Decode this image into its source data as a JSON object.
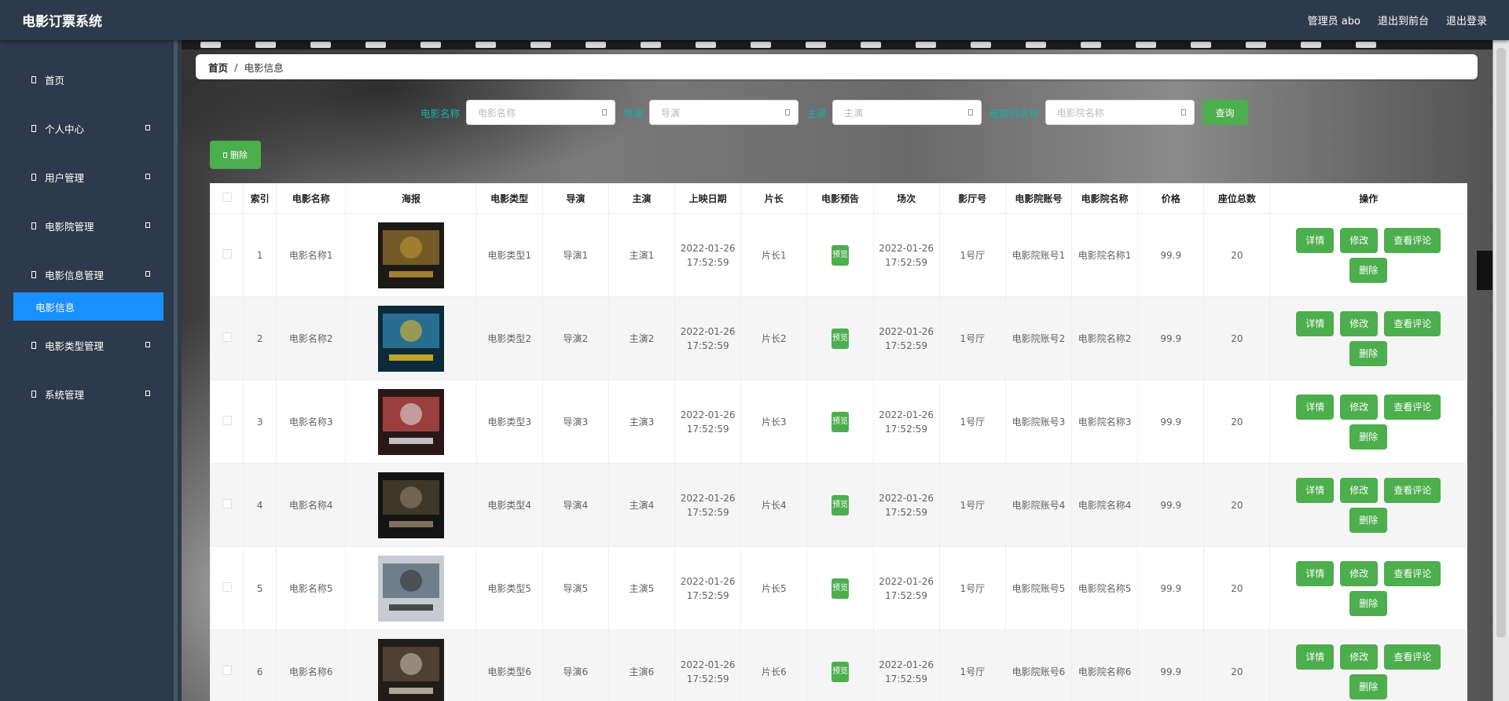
{
  "header": {
    "title": "电影订票系统",
    "user": "管理员 abo",
    "to_front": "退出到前台",
    "logout": "退出登录"
  },
  "sidebar": {
    "items": [
      {
        "label": "首页",
        "has_arrow": false
      },
      {
        "label": "个人中心",
        "has_arrow": true
      },
      {
        "label": "用户管理",
        "has_arrow": true
      },
      {
        "label": "电影院管理",
        "has_arrow": true
      },
      {
        "label": "电影信息管理",
        "has_arrow": true
      },
      {
        "label": "电影类型管理",
        "has_arrow": true
      },
      {
        "label": "系统管理",
        "has_arrow": true
      }
    ],
    "active_sub": "电影信息"
  },
  "breadcrumb": {
    "home": "首页",
    "separator": "/",
    "current": "电影信息"
  },
  "search": {
    "fields": [
      {
        "label": "电影名称",
        "placeholder": "电影名称"
      },
      {
        "label": "导演",
        "placeholder": "导演"
      },
      {
        "label": "主演",
        "placeholder": "主演"
      },
      {
        "label": "电影院名称",
        "placeholder": "电影院名称"
      }
    ],
    "query_label": "查询"
  },
  "toolbar": {
    "delete_label": "删除"
  },
  "table": {
    "columns": [
      "索引",
      "电影名称",
      "海报",
      "电影类型",
      "导演",
      "主演",
      "上映日期",
      "片长",
      "电影预告",
      "场次",
      "影厅号",
      "电影院账号",
      "电影院名称",
      "价格",
      "座位总数",
      "操作"
    ],
    "rows": [
      {
        "index": "1",
        "name": "电影名称1",
        "type": "电影类型1",
        "director": "导演1",
        "actor": "主演1",
        "date": "2022-01-26",
        "time": "17:52:59",
        "length": "片长1",
        "preview": "预览",
        "session_date": "2022-01-26",
        "session_time": "17:52:59",
        "hall": "1号厅",
        "account": "电影院账号1",
        "cinema": "电影院名称1",
        "price": "99.9",
        "seats": "20"
      },
      {
        "index": "2",
        "name": "电影名称2",
        "type": "电影类型2",
        "director": "导演2",
        "actor": "主演2",
        "date": "2022-01-26",
        "time": "17:52:59",
        "length": "片长2",
        "preview": "预览",
        "session_date": "2022-01-26",
        "session_time": "17:52:59",
        "hall": "1号厅",
        "account": "电影院账号2",
        "cinema": "电影院名称2",
        "price": "99.9",
        "seats": "20"
      },
      {
        "index": "3",
        "name": "电影名称3",
        "type": "电影类型3",
        "director": "导演3",
        "actor": "主演3",
        "date": "2022-01-26",
        "time": "17:52:59",
        "length": "片长3",
        "preview": "预览",
        "session_date": "2022-01-26",
        "session_time": "17:52:59",
        "hall": "1号厅",
        "account": "电影院账号3",
        "cinema": "电影院名称3",
        "price": "99.9",
        "seats": "20"
      },
      {
        "index": "4",
        "name": "电影名称4",
        "type": "电影类型4",
        "director": "导演4",
        "actor": "主演4",
        "date": "2022-01-26",
        "time": "17:52:59",
        "length": "片长4",
        "preview": "预览",
        "session_date": "2022-01-26",
        "session_time": "17:52:59",
        "hall": "1号厅",
        "account": "电影院账号4",
        "cinema": "电影院名称4",
        "price": "99.9",
        "seats": "20"
      },
      {
        "index": "5",
        "name": "电影名称5",
        "type": "电影类型5",
        "director": "导演5",
        "actor": "主演5",
        "date": "2022-01-26",
        "time": "17:52:59",
        "length": "片长5",
        "preview": "预览",
        "session_date": "2022-01-26",
        "session_time": "17:52:59",
        "hall": "1号厅",
        "account": "电影院账号5",
        "cinema": "电影院名称5",
        "price": "99.9",
        "seats": "20"
      },
      {
        "index": "6",
        "name": "电影名称6",
        "type": "电影类型6",
        "director": "导演6",
        "actor": "主演6",
        "date": "2022-01-26",
        "time": "17:52:59",
        "length": "片长6",
        "preview": "预览",
        "session_date": "2022-01-26",
        "session_time": "17:52:59",
        "hall": "1号厅",
        "account": "电影院账号6",
        "cinema": "电影院名称6",
        "price": "99.9",
        "seats": "20"
      }
    ],
    "ops": [
      "详情",
      "修改",
      "查看评论",
      "删除"
    ]
  },
  "colors": {
    "sidebar_bg": "#2d3a4b",
    "active": "#1890ff",
    "button": "#4cae4c",
    "label": "#15b3a3"
  }
}
